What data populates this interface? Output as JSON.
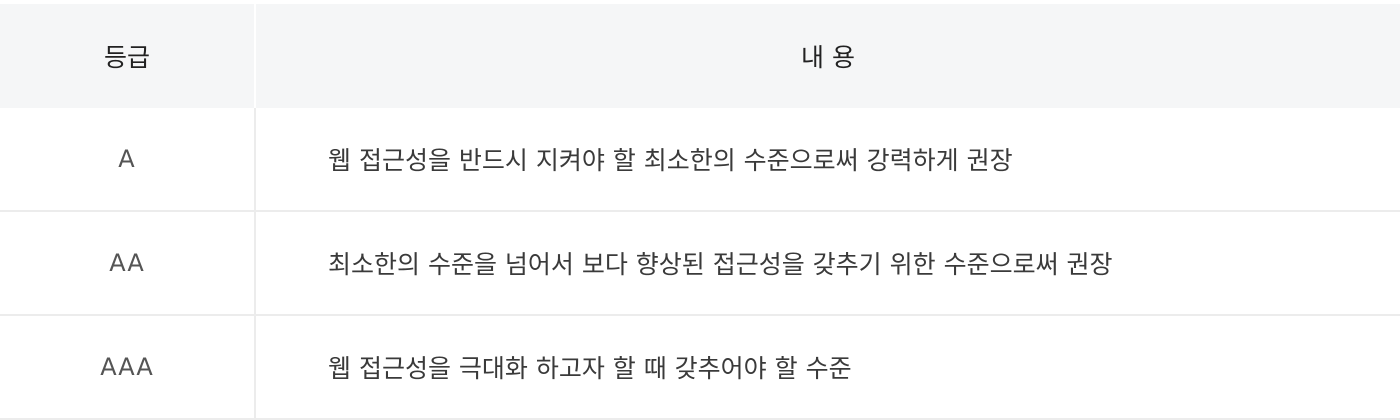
{
  "table": {
    "headers": {
      "grade": "등급",
      "content": "내 용"
    },
    "rows": [
      {
        "grade": "A",
        "content": "웹 접근성을 반드시 지켜야 할 최소한의 수준으로써 강력하게 권장"
      },
      {
        "grade": "AA",
        "content": "최소한의 수준을 넘어서 보다 향상된 접근성을 갖추기 위한 수준으로써 권장"
      },
      {
        "grade": "AAA",
        "content": "웹 접근성을 극대화 하고자 할 때 갖추어야 할 수준"
      }
    ]
  }
}
